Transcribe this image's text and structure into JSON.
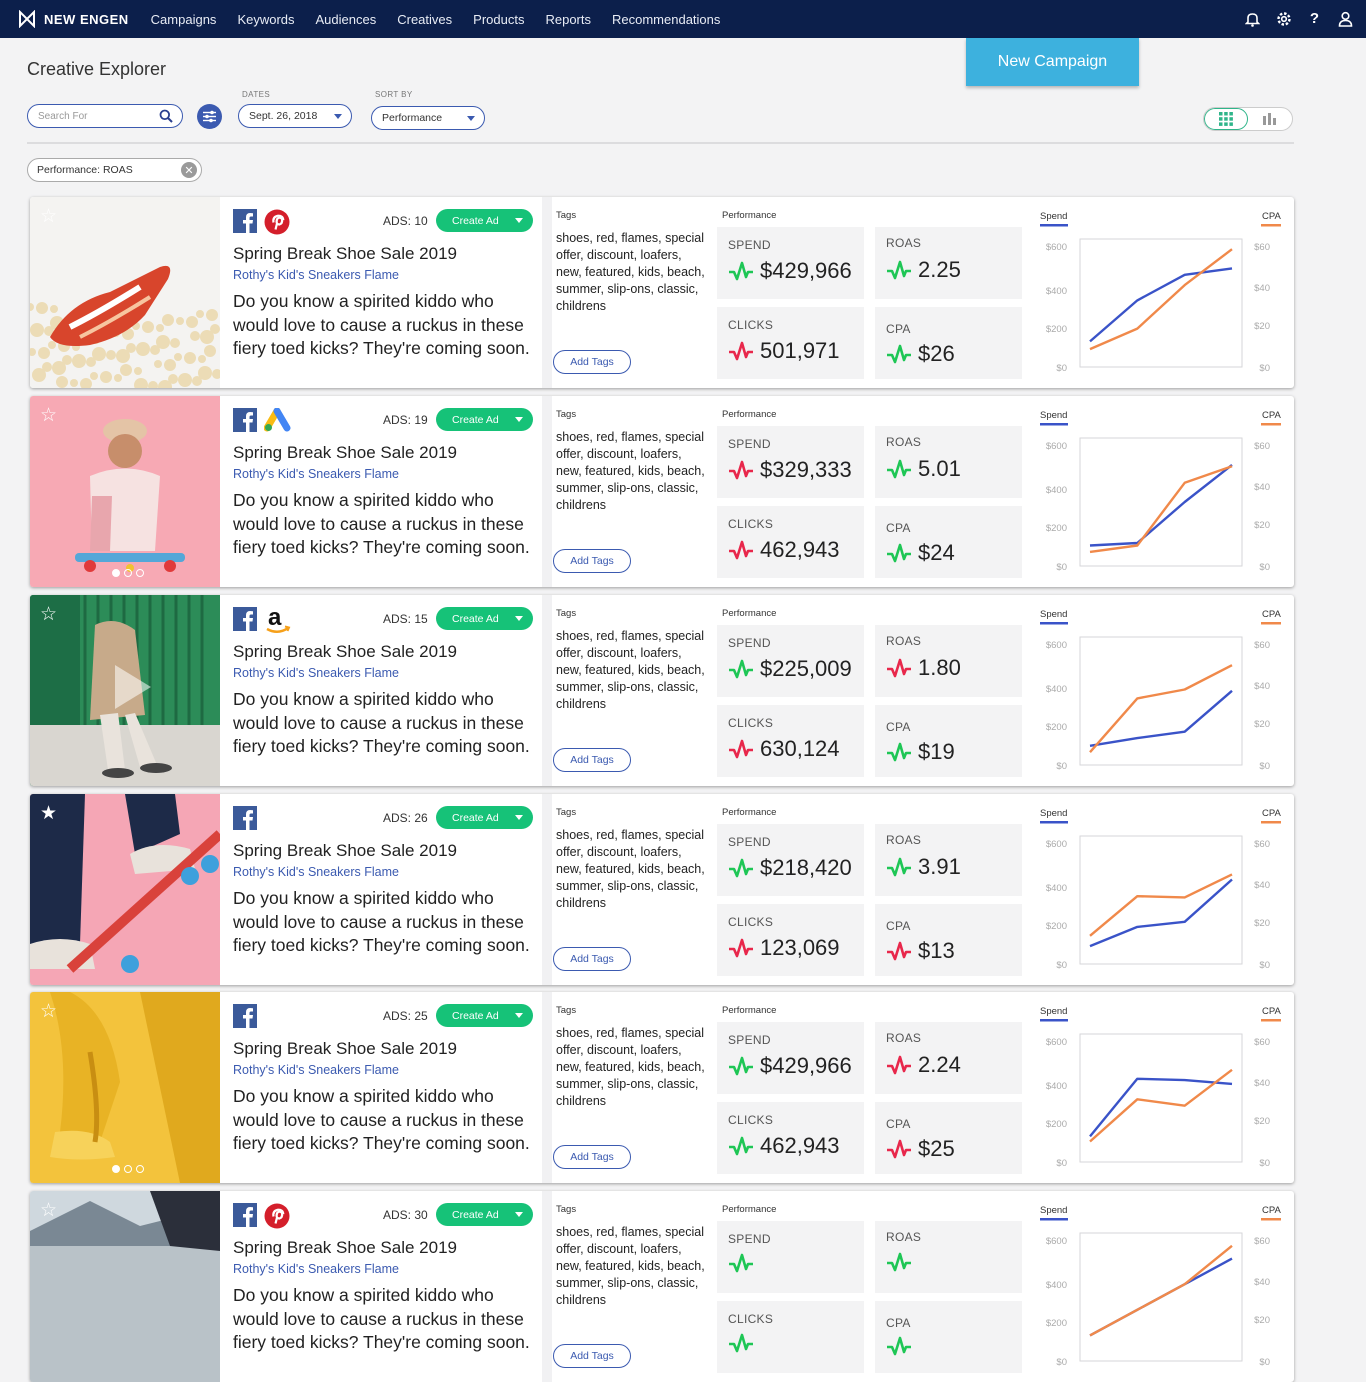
{
  "nav": {
    "brand": "NEW ENGEN",
    "items": [
      "Campaigns",
      "Keywords",
      "Audiences",
      "Creatives",
      "Products",
      "Reports",
      "Recommendations"
    ]
  },
  "page": {
    "title": "Creative Explorer",
    "new_campaign_label": "New Campaign",
    "search_placeholder": "Search For",
    "dates_label": "DATES",
    "date_value": "Sept. 26, 2018",
    "sort_label": "SORT BY",
    "sort_value": "Performance",
    "filter_chip": "Performance: ROAS"
  },
  "labels": {
    "create_ad": "Create Ad",
    "tags": "Tags",
    "add_tags": "Add Tags",
    "performance": "Performance",
    "spend": "SPEND",
    "roas": "ROAS",
    "clicks": "CLICKS",
    "cpa": "CPA",
    "chart_spend": "Spend",
    "chart_cpa": "CPA",
    "ads_prefix": "ADS: "
  },
  "colors": {
    "nav_bg": "#0c1f4b",
    "accent_blue": "#3b5ab0",
    "create_green": "#16c278",
    "up_green": "#1ec655",
    "down_red": "#e8274b",
    "spend_line": "#3a53c8",
    "cpa_line": "#f0894a",
    "new_campaign": "#3db1de"
  },
  "cards": [
    {
      "ads": "10",
      "channels": [
        "facebook-icon",
        "pinterest-icon"
      ],
      "title": "Spring Break Shoe Sale 2019",
      "subtitle": "Rothy's Kid's Sneakers Flame",
      "body": "Do you know a spirited kiddo who would love to cause a ruckus in these fiery toed kicks? They're coming soon.",
      "tags": "shoes, red, flames, special offer, discount, loafers, new, featured, kids, beach, summer, slip-ons, classic, childrens",
      "spend": "$429,966",
      "spend_trend": "up",
      "roas": "2.25",
      "roas_trend": "up",
      "clicks": "501,971",
      "clicks_trend": "down",
      "cpa": "$26",
      "cpa_trend": "up",
      "image": "popcorn-shoe",
      "dots": false,
      "play": false,
      "star_filled": false,
      "chart_data": {
        "type": "line",
        "y_left": [
          "$600",
          "$400",
          "$200",
          "$0"
        ],
        "y_right": [
          "$60",
          "$40",
          "$20",
          "$0"
        ],
        "series": [
          {
            "name": "Spend",
            "values": [
              0.2,
              0.52,
              0.72,
              0.77
            ]
          },
          {
            "name": "CPA",
            "values": [
              0.14,
              0.3,
              0.64,
              0.92
            ]
          }
        ]
      }
    },
    {
      "ads": "19",
      "channels": [
        "facebook-icon",
        "google-ads-icon"
      ],
      "title": "Spring Break Shoe Sale 2019",
      "subtitle": "Rothy's Kid's Sneakers Flame",
      "body": "Do you know a spirited kiddo who would love to cause a ruckus in these fiery toed kicks? They're coming soon.",
      "tags": "shoes, red, flames, special offer, discount, loafers, new, featured, kids, beach, summer, slip-ons, classic, childrens",
      "spend": "$329,333",
      "spend_trend": "down",
      "roas": "5.01",
      "roas_trend": "up",
      "clicks": "462,943",
      "clicks_trend": "down",
      "cpa": "$24",
      "cpa_trend": "up",
      "image": "girl-skateboard",
      "dots": true,
      "play": false,
      "star_filled": false,
      "chart_data": {
        "type": "line",
        "y_left": [
          "$600",
          "$400",
          "$200",
          "$0"
        ],
        "y_right": [
          "$60",
          "$40",
          "$20",
          "$0"
        ],
        "series": [
          {
            "name": "Spend",
            "values": [
              0.16,
              0.18,
              0.5,
              0.79
            ]
          },
          {
            "name": "CPA",
            "values": [
              0.11,
              0.16,
              0.65,
              0.78
            ]
          }
        ]
      }
    },
    {
      "ads": "15",
      "channels": [
        "facebook-icon",
        "amazon-icon"
      ],
      "title": "Spring Break Shoe Sale 2019",
      "subtitle": "Rothy's Kid's Sneakers Flame",
      "body": "Do you know a spirited kiddo who would love to cause a ruckus in these fiery toed kicks? They're coming soon.",
      "tags": "shoes, red, flames, special offer, discount, loafers, new, featured, kids, beach, summer, slip-ons, classic, childrens",
      "spend": "$225,009",
      "spend_trend": "up",
      "roas": "1.80",
      "roas_trend": "down",
      "clicks": "630,124",
      "clicks_trend": "down",
      "cpa": "$19",
      "cpa_trend": "up",
      "image": "green-door",
      "dots": false,
      "play": true,
      "star_filled": false,
      "chart_data": {
        "type": "line",
        "y_left": [
          "$600",
          "$400",
          "$200",
          "$0"
        ],
        "y_right": [
          "$60",
          "$40",
          "$20",
          "$0"
        ],
        "series": [
          {
            "name": "Spend",
            "values": [
              0.15,
              0.21,
              0.26,
              0.58
            ]
          },
          {
            "name": "CPA",
            "values": [
              0.1,
              0.52,
              0.59,
              0.78
            ]
          }
        ]
      }
    },
    {
      "ads": "26",
      "channels": [
        "facebook-icon"
      ],
      "title": "Spring Break Shoe Sale 2019",
      "subtitle": "Rothy's Kid's Sneakers Flame",
      "body": "Do you know a spirited kiddo who would love to cause a ruckus in these fiery toed kicks? They're coming soon.",
      "tags": "shoes, red, flames, special offer, discount, loafers, new, featured, kids, beach, summer, slip-ons, classic, childrens",
      "spend": "$218,420",
      "spend_trend": "up",
      "roas": "3.91",
      "roas_trend": "up",
      "clicks": "123,069",
      "clicks_trend": "down",
      "cpa": "$13",
      "cpa_trend": "down",
      "image": "pink-skate",
      "dots": false,
      "play": false,
      "star_filled": true,
      "chart_data": {
        "type": "line",
        "y_left": [
          "$600",
          "$400",
          "$200",
          "$0"
        ],
        "y_right": [
          "$60",
          "$40",
          "$20",
          "$0"
        ],
        "series": [
          {
            "name": "Spend",
            "values": [
              0.14,
              0.29,
              0.33,
              0.66
            ]
          },
          {
            "name": "CPA",
            "values": [
              0.22,
              0.53,
              0.52,
              0.7
            ]
          }
        ]
      }
    },
    {
      "ads": "25",
      "channels": [
        "facebook-icon"
      ],
      "title": "Spring Break Shoe Sale 2019",
      "subtitle": "Rothy's Kid's Sneakers Flame",
      "body": "Do you know a spirited kiddo who would love to cause a ruckus in these fiery toed kicks? They're coming soon.",
      "tags": "shoes, red, flames, special offer, discount, loafers, new, featured, kids, beach, summer, slip-ons, classic, childrens",
      "spend": "$429,966",
      "spend_trend": "up",
      "roas": "2.24",
      "roas_trend": "down",
      "clicks": "462,943",
      "clicks_trend": "up",
      "cpa": "$25",
      "cpa_trend": "down",
      "image": "yellow-shoe",
      "dots": true,
      "play": false,
      "star_filled": false,
      "chart_data": {
        "type": "line",
        "y_left": [
          "$600",
          "$400",
          "$200",
          "$0"
        ],
        "y_right": [
          "$60",
          "$40",
          "$20",
          "$0"
        ],
        "series": [
          {
            "name": "Spend",
            "values": [
              0.2,
              0.65,
              0.64,
              0.61
            ]
          },
          {
            "name": "CPA",
            "values": [
              0.16,
              0.49,
              0.44,
              0.72
            ]
          }
        ]
      }
    },
    {
      "ads": "30",
      "channels": [
        "facebook-icon",
        "pinterest-icon"
      ],
      "title": "Spring Break Shoe Sale 2019",
      "subtitle": "Rothy's Kid's Sneakers Flame",
      "body": "Do you know a spirited kiddo who would love to cause a ruckus in these fiery toed kicks? They're coming soon.",
      "tags": "shoes, red, flames, special offer, discount, loafers, new, featured, kids, beach, summer, slip-ons, classic, childrens",
      "spend": "",
      "spend_trend": "up",
      "roas": "",
      "roas_trend": "up",
      "clicks": "",
      "clicks_trend": "up",
      "cpa": "",
      "cpa_trend": "up",
      "image": "mountain",
      "dots": false,
      "play": false,
      "star_filled": false,
      "chart_data": {
        "type": "line",
        "y_left": [
          "$600",
          "$400",
          "$200",
          "$0"
        ],
        "y_right": [
          "$60",
          "$40",
          "$20",
          "$0"
        ],
        "series": [
          {
            "name": "Spend",
            "values": [
              0.2,
              0.4,
              0.6,
              0.8
            ]
          },
          {
            "name": "CPA",
            "values": [
              0.2,
              0.4,
              0.6,
              0.9
            ]
          }
        ]
      }
    }
  ]
}
